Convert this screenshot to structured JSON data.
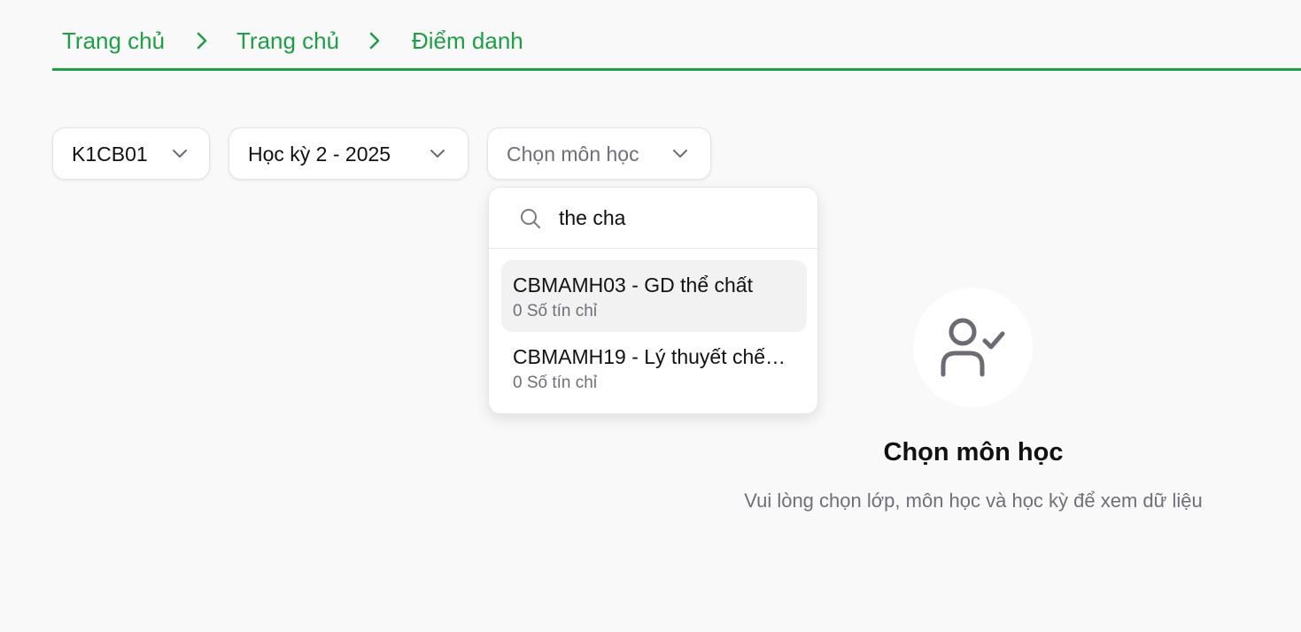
{
  "breadcrumb": {
    "items": [
      "Trang chủ",
      "Trang chủ",
      "Điểm danh"
    ]
  },
  "filters": {
    "class_value": "K1CB01",
    "semester_value": "Học kỳ 2 - 2025",
    "subject_placeholder": "Chọn môn học"
  },
  "subject_dropdown": {
    "search_value": "the cha",
    "options": [
      {
        "title": "CBMAMH03 - GD thể chất",
        "credits": "0 Số tín chỉ",
        "highlighted": true
      },
      {
        "title": "CBMAMH19 - Lý thuyết chế…",
        "credits": "0 Số tín chỉ",
        "highlighted": false
      }
    ]
  },
  "empty_state": {
    "title": "Chọn môn học",
    "description": "Vui lòng chọn lớp, môn học và học kỳ để xem dữ liệu",
    "icon": "user-check-icon"
  },
  "colors": {
    "accent": "#1e9e45",
    "background": "#f9f9f9",
    "muted_text": "#6f6f78",
    "icon_gray": "#6b6b73"
  }
}
